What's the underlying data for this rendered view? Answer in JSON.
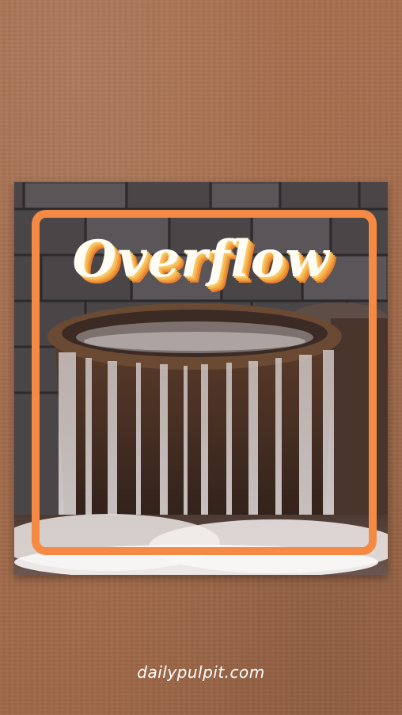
{
  "title": "Overflow",
  "footer": {
    "website": "dailypulpit.com"
  },
  "colors": {
    "background": "#a56e4f",
    "frame_accent": "#f58a45",
    "title_fill": "#fffdf3",
    "title_shadow": "#f29a3c"
  },
  "image": {
    "icon": "overflowing-fountain-photo"
  }
}
